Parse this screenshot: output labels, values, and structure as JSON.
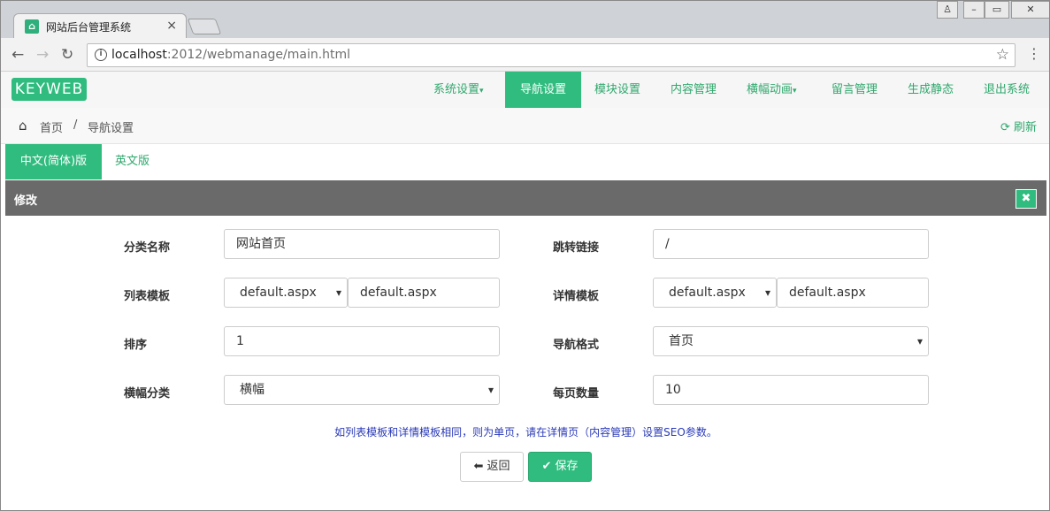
{
  "browser": {
    "tab_title": "网站后台管理系统",
    "tab_close": "×",
    "url_host": "localhost",
    "url_rest": ":2012/webmanage/main.html",
    "info_icon": "i"
  },
  "app": {
    "logo": "KEYWEB",
    "nav": [
      {
        "label": "系统设置",
        "dropdown": true
      },
      {
        "label": "导航设置",
        "active": true
      },
      {
        "label": "模块设置"
      },
      {
        "label": "内容管理"
      },
      {
        "label": "横幅动画",
        "dropdown": true
      },
      {
        "label": "留言管理"
      },
      {
        "label": "生成静态"
      },
      {
        "label": "退出系统"
      }
    ],
    "caret": "▾"
  },
  "breadcrumb": {
    "home": "首页",
    "separator": "/",
    "current": "导航设置",
    "refresh": "刷新"
  },
  "lang_tabs": [
    "中文(简体)版",
    "英文版"
  ],
  "panel": {
    "title": "修改",
    "close_icon": "✖"
  },
  "form": {
    "category_name": {
      "label": "分类名称",
      "value": "网站首页"
    },
    "redirect_link": {
      "label": "跳转链接",
      "value": "/"
    },
    "list_template": {
      "label": "列表模板",
      "select": "default.aspx",
      "value": "default.aspx"
    },
    "detail_template": {
      "label": "详情模板",
      "select": "default.aspx",
      "value": "default.aspx"
    },
    "sort": {
      "label": "排序",
      "value": "1"
    },
    "nav_style": {
      "label": "导航格式",
      "value": "首页"
    },
    "banner_category": {
      "label": "横幅分类",
      "value": "横幅"
    },
    "page_size": {
      "label": "每页数量",
      "value": "10"
    }
  },
  "notice": "如列表模板和详情模板相同，则为单页，请在详情页（内容管理）设置SEO参数。",
  "buttons": {
    "back": "返回",
    "save": "保存"
  },
  "colors": {
    "accent": "#2fbc7e",
    "panel_header": "#6a6a6a",
    "notice": "#2a3ab8"
  }
}
